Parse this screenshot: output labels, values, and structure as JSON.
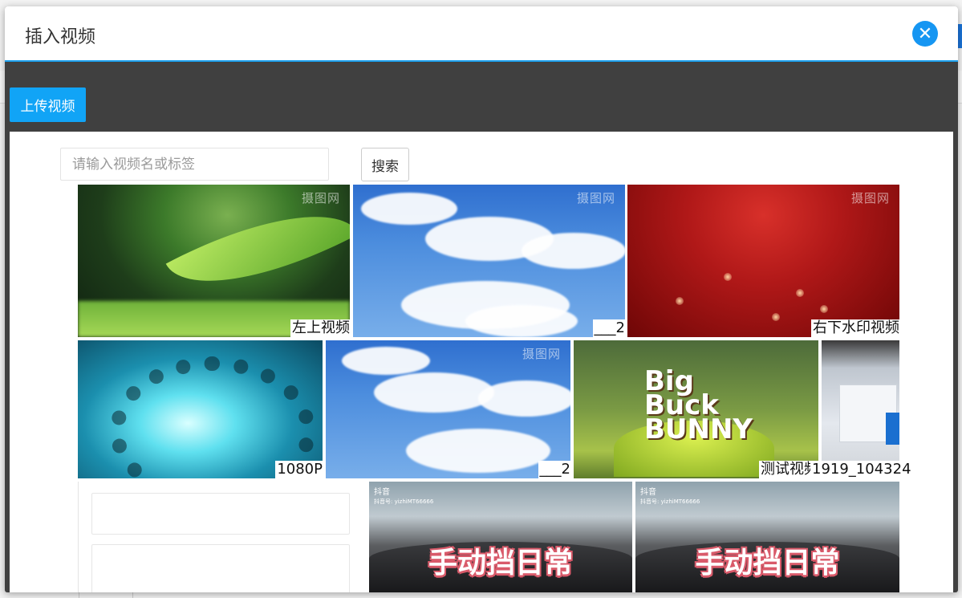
{
  "dialog": {
    "title": "插入视频",
    "close_glyph": "✕",
    "upload_label": "上传视频"
  },
  "search": {
    "placeholder": "请输入视频名或标签",
    "button_label": "搜索"
  },
  "videos": [
    {
      "label": "左上视频",
      "watermark": "摄图网"
    },
    {
      "label": "___2",
      "watermark": "摄图网"
    },
    {
      "label": "右下水印视频",
      "watermark": "摄图网"
    },
    {
      "label": "1080P"
    },
    {
      "label": "___2",
      "watermark": "摄图网"
    },
    {
      "label": "测试视频",
      "overlay": "Big Buck BUNNY"
    },
    {
      "label": "1919_104324"
    },
    {
      "label": ""
    },
    {
      "label": "",
      "overlay": "手动挡日常",
      "logo": "抖音",
      "account": "抖音号: yizhiMT66666"
    },
    {
      "label": "",
      "overlay": "手动挡日常",
      "logo": "抖音",
      "account": "抖音号: yizhiMT66666"
    }
  ],
  "colors": {
    "accent": "#1ea2ef",
    "upload_button": "#11a4f6",
    "close_button": "#1696f2",
    "toolbar_bg": "#404040"
  }
}
